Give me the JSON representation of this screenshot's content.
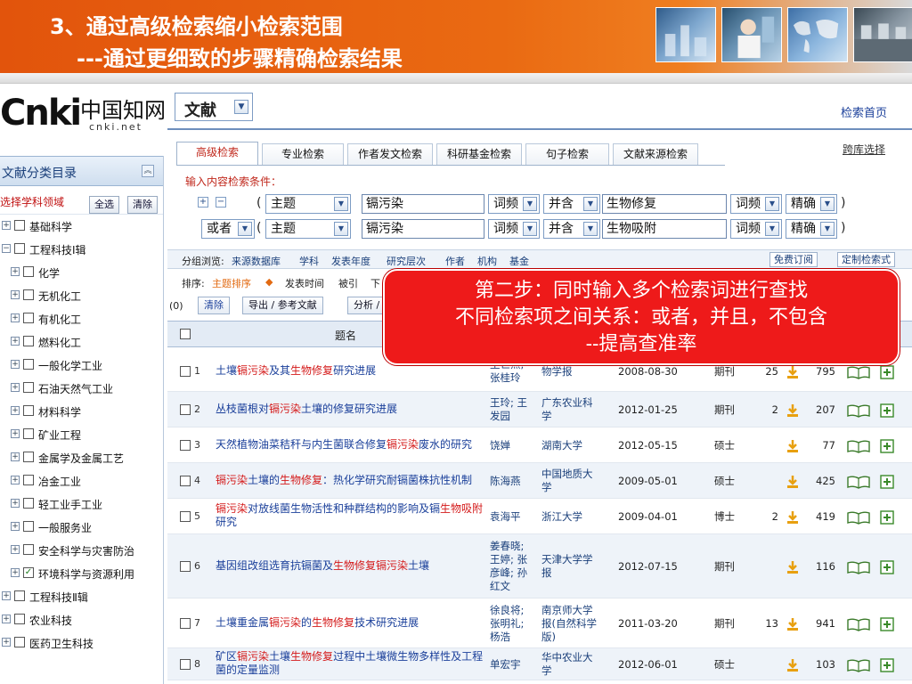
{
  "slide": {
    "title_line1": "3、通过高级检索缩小检索范围",
    "title_line2": "---通过更细致的步骤精确检索结果"
  },
  "logo": {
    "main": "Cnki",
    "chinese": "中国知网",
    "sub": "cnki.net"
  },
  "doc_type": {
    "selected": "文献"
  },
  "home_link": "检索首页",
  "tabs": [
    {
      "label": "高级检索",
      "active": true
    },
    {
      "label": "专业检索"
    },
    {
      "label": "作者发文检索"
    },
    {
      "label": "科研基金检索"
    },
    {
      "label": "句子检索"
    },
    {
      "label": "文献来源检索"
    }
  ],
  "cross_db_link": "跨库选择",
  "search_form": {
    "label": "输入内容检索条件：",
    "rows": [
      {
        "logic": "",
        "open_paren": "(",
        "field1": "主题",
        "term1": "镉污染",
        "freq1": "词频",
        "relation": "并含",
        "term2": "生物修复",
        "freq2": "词频",
        "match": "精确",
        "close_paren": ")"
      },
      {
        "logic": "或者",
        "open_paren": "(",
        "field1": "主题",
        "term1": "镉污染",
        "freq1": "词频",
        "relation": "并含",
        "term2": "生物吸附",
        "freq2": "词频",
        "match": "精确",
        "close_paren": ")"
      }
    ]
  },
  "browse_bar": {
    "label": "分组浏览:",
    "items": [
      "来源数据库",
      "学科",
      "发表年度",
      "研究层次",
      "作者",
      "机构",
      "基金"
    ],
    "buttons": [
      "免费订阅",
      "定制检索式"
    ]
  },
  "sort_bar": {
    "label": "排序:",
    "items": [
      "主题排序",
      "发表时间",
      "被引",
      "下"
    ]
  },
  "actions": {
    "count": "(0)",
    "clear": "清除",
    "export": "导出 / 参考文献",
    "analyze": "分析 /"
  },
  "table": {
    "title_header": "题名",
    "rows": [
      {
        "n": "1",
        "title": [
          "土壤",
          "镉污染",
          "及其",
          "生物修复",
          "研究进展"
        ],
        "author": "王世杰;\n张桂玲",
        "source": "物学报",
        "date": "2008-08-30",
        "type": "期刊",
        "cite": "25",
        "downloads": "795"
      },
      {
        "n": "2",
        "title": [
          "丛枝菌根对",
          "镉污染",
          "土壤的修复研究进展"
        ],
        "author": "王玲; 王\n发园",
        "source": "广东农业科\n学",
        "date": "2012-01-25",
        "type": "期刊",
        "cite": "2",
        "downloads": "207"
      },
      {
        "n": "3",
        "title": [
          "天然植物油菜秸秆与内生菌联合修复",
          "镉污染",
          "废水的研究"
        ],
        "author": "饶婵",
        "source": "湖南大学",
        "date": "2012-05-15",
        "type": "硕士",
        "cite": "",
        "downloads": "77"
      },
      {
        "n": "4",
        "title": [
          "",
          "镉污染",
          "土壤的",
          "生物修复",
          "：热化学研究耐镉菌株抗性机制"
        ],
        "author": "陈海燕",
        "source": "中国地质大\n学",
        "date": "2009-05-01",
        "type": "硕士",
        "cite": "",
        "downloads": "425"
      },
      {
        "n": "5",
        "title": [
          "",
          "镉污染",
          "对放线菌生物活性和种群结构的影响及镉",
          "生物吸附",
          "研究"
        ],
        "author": "袁海平",
        "source": "浙江大学",
        "date": "2009-04-01",
        "type": "博士",
        "cite": "2",
        "downloads": "419"
      },
      {
        "n": "6",
        "title": [
          "基因组改组选育抗镉菌及",
          "生物修复",
          "",
          "镉污染",
          "土壤"
        ],
        "author": "姜春晓;\n王婷; 张\n彦峰; 孙\n红文",
        "source": "天津大学学\n报",
        "date": "2012-07-15",
        "type": "期刊",
        "cite": "",
        "downloads": "116"
      },
      {
        "n": "7",
        "title": [
          "土壤重金属",
          "镉污染",
          "的",
          "生物修复",
          "技术研究进展"
        ],
        "author": "徐良将;\n张明礼;\n杨浩",
        "source": "南京师大学\n报(自然科学\n版)",
        "date": "2011-03-20",
        "type": "期刊",
        "cite": "13",
        "downloads": "941"
      },
      {
        "n": "8",
        "title": [
          "矿区",
          "镉污染",
          "土壤",
          "生物修复",
          "过程中土壤微生物多样性及工程菌的定量监测"
        ],
        "author": "单宏宇",
        "source": "华中农业大\n学",
        "date": "2012-06-01",
        "type": "硕士",
        "cite": "",
        "downloads": "103"
      }
    ]
  },
  "sidebar": {
    "title": "文献分类目录",
    "subject_label": "选择学科领域",
    "select_all": "全选",
    "clear": "清除",
    "items": [
      {
        "label": "基础科学",
        "level": 0,
        "checked": false
      },
      {
        "label": "工程科技Ⅰ辑",
        "level": 0,
        "expanded": true,
        "checked": false
      },
      {
        "label": "化学",
        "level": 1,
        "checked": false
      },
      {
        "label": "无机化工",
        "level": 1,
        "checked": false
      },
      {
        "label": "有机化工",
        "level": 1,
        "checked": false
      },
      {
        "label": "燃料化工",
        "level": 1,
        "checked": false
      },
      {
        "label": "一般化学工业",
        "level": 1,
        "checked": false
      },
      {
        "label": "石油天然气工业",
        "level": 1,
        "checked": false
      },
      {
        "label": "材料科学",
        "level": 1,
        "checked": false
      },
      {
        "label": "矿业工程",
        "level": 1,
        "checked": false
      },
      {
        "label": "金属学及金属工艺",
        "level": 1,
        "checked": false
      },
      {
        "label": "冶金工业",
        "level": 1,
        "checked": false
      },
      {
        "label": "轻工业手工业",
        "level": 1,
        "checked": false
      },
      {
        "label": "一般服务业",
        "level": 1,
        "checked": false
      },
      {
        "label": "安全科学与灾害防治",
        "level": 1,
        "checked": false
      },
      {
        "label": "环境科学与资源利用",
        "level": 1,
        "checked": true
      },
      {
        "label": "工程科技Ⅱ辑",
        "level": 0,
        "checked": false
      },
      {
        "label": "农业科技",
        "level": 0,
        "checked": false
      },
      {
        "label": "医药卫生科技",
        "level": 0,
        "checked": false
      }
    ]
  },
  "callout": {
    "line1": "第二步：同时输入多个检索词进行查找",
    "line2": "不同检索项之间关系：或者，并且，不包含",
    "line3": "--提高查准率"
  },
  "colors": {
    "header_orange": "#e2540c",
    "highlight_red": "#d41a1a",
    "link_blue": "#1a3f9a",
    "callout_red": "#ee1a1a"
  }
}
